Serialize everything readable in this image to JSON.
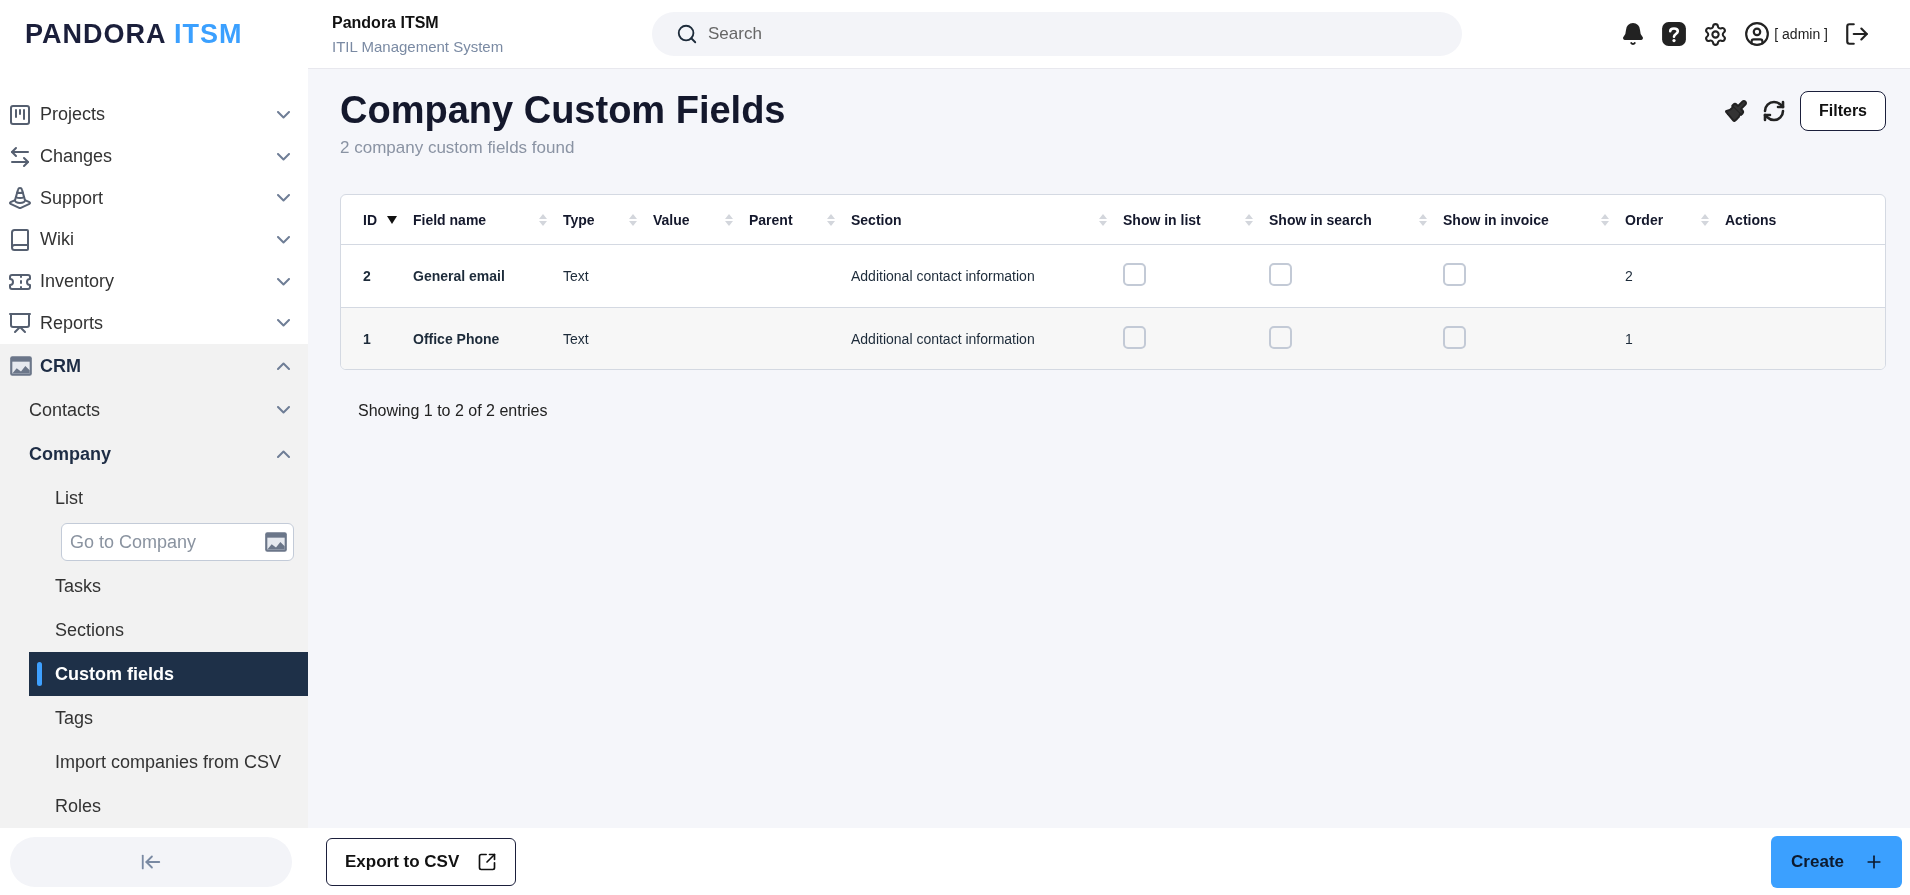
{
  "header": {
    "logo": {
      "name": "PANDORA",
      "product": "ITSM"
    },
    "app_title": "Pandora ITSM",
    "app_subtitle": "ITIL Management System",
    "search": {
      "placeholder": "Search"
    },
    "user": "[ admin ]"
  },
  "sidebar": {
    "items": [
      {
        "label": "Projects",
        "kind": "section",
        "expanded": false
      },
      {
        "label": "Changes",
        "kind": "section",
        "expanded": false
      },
      {
        "label": "Support",
        "kind": "section",
        "expanded": false
      },
      {
        "label": "Wiki",
        "kind": "section",
        "expanded": false
      },
      {
        "label": "Inventory",
        "kind": "section",
        "expanded": false
      },
      {
        "label": "Reports",
        "kind": "section",
        "expanded": false
      },
      {
        "label": "CRM",
        "kind": "section",
        "expanded": true,
        "children": [
          {
            "label": "Contacts",
            "kind": "group",
            "expanded": false
          },
          {
            "label": "Company",
            "kind": "group",
            "expanded": true,
            "children": [
              {
                "label": "List",
                "kind": "link",
                "selected": false
              },
              {
                "placeholder": "Go to Company",
                "kind": "field"
              },
              {
                "label": "Tasks",
                "kind": "link",
                "selected": false
              },
              {
                "label": "Sections",
                "kind": "link",
                "selected": false
              },
              {
                "label": "Custom fields",
                "kind": "link",
                "selected": true
              },
              {
                "label": "Tags",
                "kind": "link",
                "selected": false
              },
              {
                "label": "Import companies from CSV",
                "kind": "link",
                "selected": false
              },
              {
                "label": "Roles",
                "kind": "link",
                "selected": false
              }
            ]
          }
        ]
      }
    ]
  },
  "page": {
    "title": "Company Custom Fields",
    "subtitle": "2 company custom fields found",
    "filters_button": "Filters"
  },
  "table": {
    "columns": [
      {
        "label": "ID",
        "sortable": true,
        "sorted": true
      },
      {
        "label": "Field name",
        "sortable": true,
        "sorted": false
      },
      {
        "label": "Type",
        "sortable": true,
        "sorted": false
      },
      {
        "label": "Value",
        "sortable": true,
        "sorted": false
      },
      {
        "label": "Parent",
        "sortable": true,
        "sorted": false
      },
      {
        "label": "Section",
        "sortable": true,
        "sorted": false
      },
      {
        "label": "Show in list",
        "sortable": true,
        "sorted": false
      },
      {
        "label": "Show in search",
        "sortable": true,
        "sorted": false
      },
      {
        "label": "Show in invoice",
        "sortable": true,
        "sorted": false
      },
      {
        "label": "Order",
        "sortable": true,
        "sorted": false
      },
      {
        "label": "Actions",
        "sortable": false
      }
    ],
    "rows": [
      {
        "id": "2",
        "field_name": "General email",
        "type": "Text",
        "section": "Additional contact information",
        "show_in_list": false,
        "show_in_search": false,
        "show_in_invoice": false,
        "order": "2"
      },
      {
        "id": "1",
        "field_name": "Office Phone",
        "type": "Text",
        "section": "Additional contact information",
        "show_in_list": false,
        "show_in_search": false,
        "show_in_invoice": false,
        "order": "1"
      }
    ]
  },
  "table_info": "Showing 1 to 2 of 2 entries",
  "footer": {
    "export_button": "Export to CSV",
    "create_button": "Create"
  }
}
